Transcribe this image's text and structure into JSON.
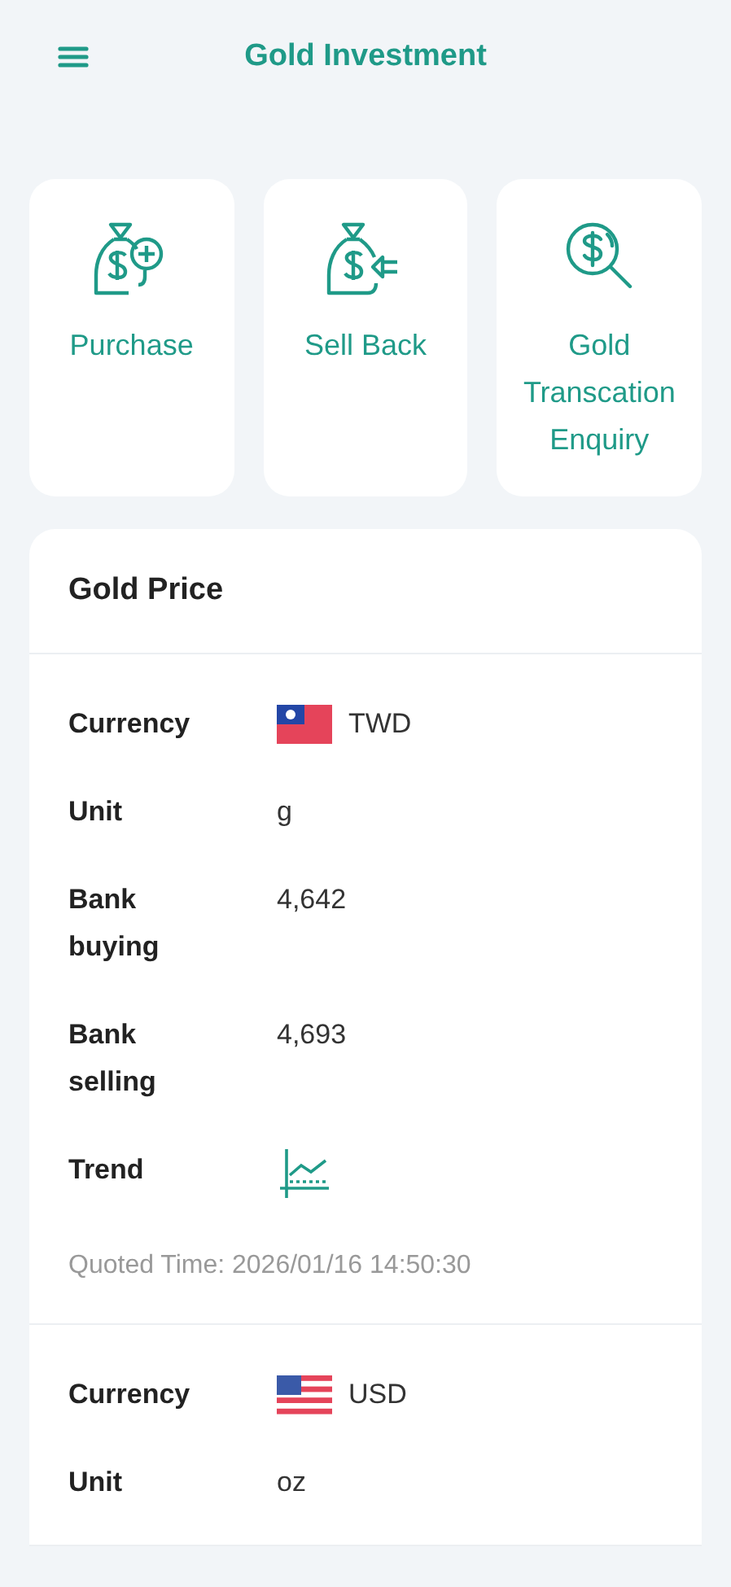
{
  "header": {
    "title": "Gold Investment"
  },
  "actions": [
    {
      "kind": "purchase",
      "label": "Purchase"
    },
    {
      "kind": "sellback",
      "label": "Sell Back"
    },
    {
      "kind": "enquiry",
      "label": "Gold Transcation Enquiry"
    }
  ],
  "price_card": {
    "title": "Gold Price",
    "quotes": [
      {
        "rows": [
          {
            "kind": "currency",
            "label": "Currency",
            "flag": {
              "kind": "tw"
            },
            "value": "TWD"
          },
          {
            "kind": "text",
            "label": "Unit",
            "value": "g"
          },
          {
            "kind": "text",
            "label": "Bank buying",
            "value": "4,642"
          },
          {
            "kind": "text",
            "label": "Bank selling",
            "value": "4,693"
          },
          {
            "kind": "trend",
            "label": "Trend"
          }
        ],
        "quoted_time": "Quoted Time: 2026/01/16 14:50:30"
      },
      {
        "rows": [
          {
            "kind": "currency",
            "label": "Currency",
            "flag": {
              "kind": "us"
            },
            "value": "USD"
          },
          {
            "kind": "text",
            "label": "Unit",
            "value": "oz"
          }
        ]
      }
    ]
  }
}
